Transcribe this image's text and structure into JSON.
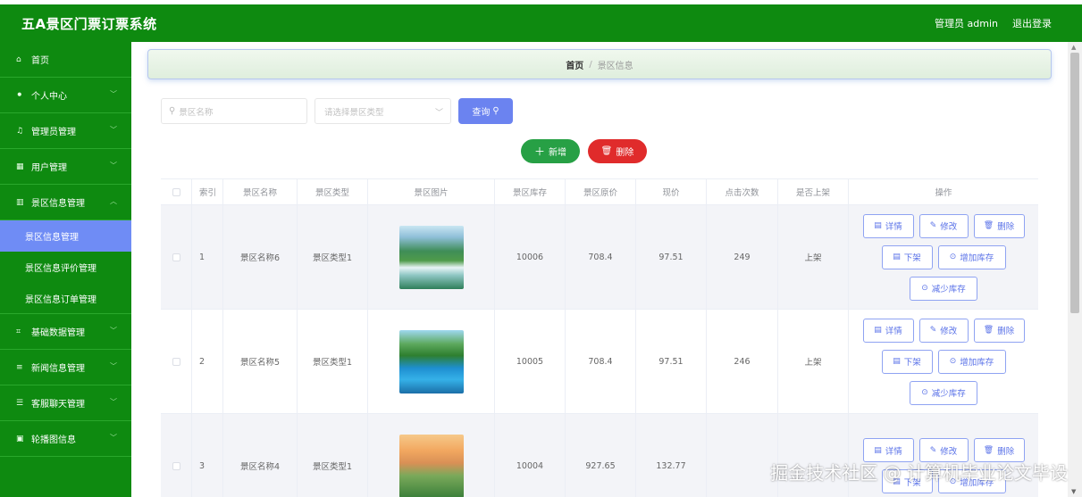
{
  "header": {
    "title": "五A景区门票订票系统",
    "user": "管理员 admin",
    "logout": "退出登录"
  },
  "sidebar": {
    "items": [
      {
        "label": "首页",
        "icon": "home-icon",
        "glyph": "⌂"
      },
      {
        "label": "个人中心",
        "icon": "user-icon",
        "glyph": "⚫"
      },
      {
        "label": "管理员管理",
        "icon": "bell-icon",
        "glyph": "♫"
      },
      {
        "label": "用户管理",
        "icon": "grid-icon",
        "glyph": "▦"
      },
      {
        "label": "景区信息管理",
        "icon": "chart-icon",
        "glyph": "▥"
      },
      {
        "label": "基础数据管理",
        "icon": "crop-icon",
        "glyph": "⌗"
      },
      {
        "label": "新闻信息管理",
        "icon": "list-icon",
        "glyph": "≡"
      },
      {
        "label": "客服聊天管理",
        "icon": "menu-icon",
        "glyph": "☰"
      },
      {
        "label": "轮播图信息",
        "icon": "picture-icon",
        "glyph": "▣"
      }
    ],
    "sub_items": [
      "景区信息管理",
      "景区信息评价管理",
      "景区信息订单管理"
    ]
  },
  "breadcrumb": {
    "home": "首页",
    "sep": "/",
    "current": "景区信息"
  },
  "search": {
    "name_placeholder": "景区名称",
    "type_placeholder": "请选择景区类型",
    "query_label": "查询"
  },
  "actions": {
    "add_label": "新增",
    "delete_label": "删除"
  },
  "table": {
    "headers": [
      "索引",
      "景区名称",
      "景区类型",
      "景区图片",
      "景区库存",
      "景区原价",
      "现价",
      "点击次数",
      "是否上架",
      "操作"
    ],
    "rows": [
      {
        "index": "1",
        "name": "景区名称6",
        "type": "景区类型1",
        "stock": "10006",
        "orig_price": "708.4",
        "price": "97.51",
        "clicks": "249",
        "on_shelf": "上架"
      },
      {
        "index": "2",
        "name": "景区名称5",
        "type": "景区类型1",
        "stock": "10005",
        "orig_price": "708.4",
        "price": "97.51",
        "clicks": "246",
        "on_shelf": "上架"
      },
      {
        "index": "3",
        "name": "景区名称4",
        "type": "景区类型1",
        "stock": "10004",
        "orig_price": "927.65",
        "price": "132.77",
        "clicks": "",
        "on_shelf": ""
      }
    ],
    "ops": {
      "detail": "详情",
      "edit": "修改",
      "delete": "删除",
      "off_shelf": "下架",
      "add_stock": "增加库存",
      "reduce_stock": "减少库存"
    }
  },
  "watermark": "掘金技术社区 @ 计算机毕业论文毕设",
  "colors": {
    "primary_green": "#0e8a10",
    "active_blue": "#6f8cf5",
    "add_green": "#27a045",
    "delete_red": "#e02b2b",
    "query_blue": "#6b83f0"
  }
}
